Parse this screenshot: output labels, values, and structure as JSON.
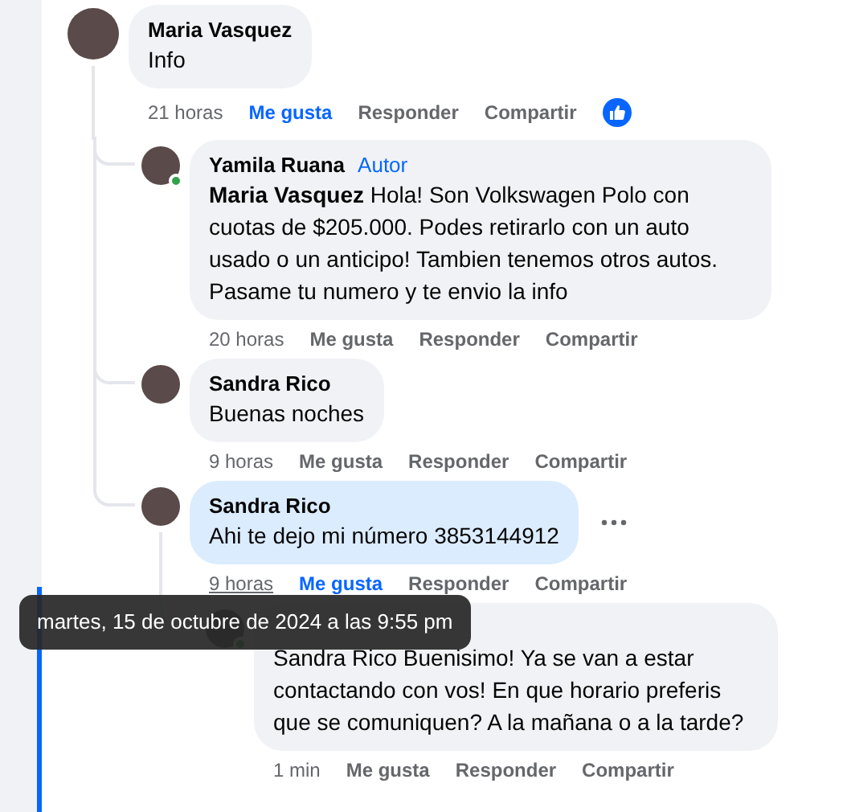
{
  "comments": [
    {
      "author": "Maria Vasquez",
      "text": "Info",
      "time": "21 horas",
      "like": "Me gusta",
      "reply": "Responder",
      "share": "Compartir",
      "liked": true,
      "reaction_shown": true,
      "online": false,
      "highlighted": false,
      "menu_shown": false,
      "time_hovered": false,
      "replies": [
        {
          "author": "Yamila Ruana",
          "badge": "Autor",
          "text": "**Maria Vasquez** Hola! Son Volkswagen Polo con cuotas de $205.000. Podes retirarlo con un auto usado o un anticipo! Tambien tenemos otros autos. Pasame tu numero y te envio la info",
          "time": "20 horas",
          "like": "Me gusta",
          "reply": "Responder",
          "share": "Compartir",
          "liked": false,
          "reaction_shown": false,
          "online": true,
          "highlighted": false,
          "menu_shown": false,
          "time_hovered": false
        },
        {
          "author": "Sandra Rico",
          "text": "Buenas noches",
          "time": "9 horas",
          "like": "Me gusta",
          "reply": "Responder",
          "share": "Compartir",
          "liked": false,
          "reaction_shown": false,
          "online": false,
          "highlighted": false,
          "menu_shown": false,
          "time_hovered": false
        },
        {
          "author": "Sandra Rico",
          "text": "Ahi te dejo mi número 3853144912",
          "time": "9 horas",
          "like": "Me gusta",
          "reply": "Responder",
          "share": "Compartir",
          "liked": true,
          "reaction_shown": false,
          "online": false,
          "highlighted": true,
          "menu_shown": true,
          "time_hovered": true,
          "replies": [
            {
              "text": "Sandra Rico Buenisimo! Ya se van a estar contactando con vos! En que horario preferis que se comuniquen? A la mañana o a la tarde?",
              "time": "1 min",
              "like": "Me gusta",
              "reply": "Responder",
              "share": "Compartir",
              "liked": false,
              "reaction_shown": false,
              "online": true,
              "highlighted": false,
              "menu_shown": false,
              "time_hovered": false
            }
          ]
        }
      ]
    }
  ],
  "tooltip": {
    "text": "martes, 15 de octubre de 2024 a las 9:55 pm"
  }
}
